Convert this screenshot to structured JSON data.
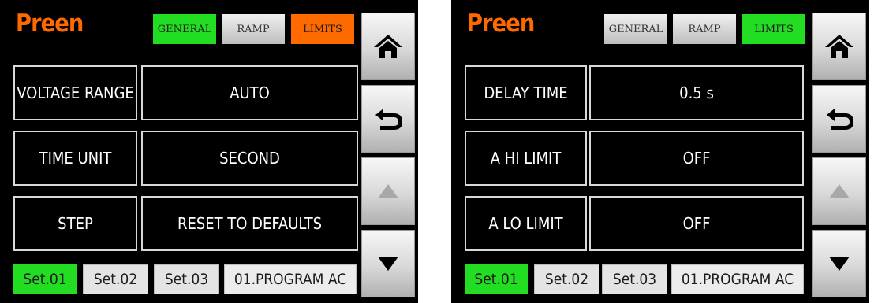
{
  "left_screen": {
    "brand": "Preen",
    "tabs": [
      {
        "label": "GENERAL",
        "state": "green"
      },
      {
        "label": "RAMP",
        "state": "gray"
      },
      {
        "label": "LIMITS",
        "state": "orange"
      }
    ],
    "rows": [
      {
        "label": "VOLTAGE RANGE",
        "value": "AUTO"
      },
      {
        "label": "TIME UNIT",
        "value": "SECOND"
      },
      {
        "label": "STEP",
        "value": "RESET TO DEFAULTS"
      }
    ],
    "sets": [
      "Set.01",
      "Set.02",
      "Set.03"
    ],
    "program": "01.PROGRAM AC"
  },
  "right_screen": {
    "brand": "Preen",
    "tabs": [
      {
        "label": "GENERAL",
        "state": "gray"
      },
      {
        "label": "RAMP",
        "state": "gray"
      },
      {
        "label": "LIMITS",
        "state": "green"
      }
    ],
    "rows": [
      {
        "label": "DELAY TIME",
        "value": "0.5 s"
      },
      {
        "label": "A HI LIMIT",
        "value": "OFF"
      },
      {
        "label": "A LO LIMIT",
        "value": "OFF"
      }
    ],
    "sets": [
      "Set.01",
      "Set.02",
      "Set.03"
    ],
    "program": "01.PROGRAM AC"
  },
  "side_buttons": [
    "home-icon",
    "back-icon",
    "up-arrow-icon",
    "down-arrow-icon"
  ],
  "colors": {
    "active_green": "#22dd22",
    "active_orange": "#ff6a00",
    "brand": "#ff6a00"
  }
}
